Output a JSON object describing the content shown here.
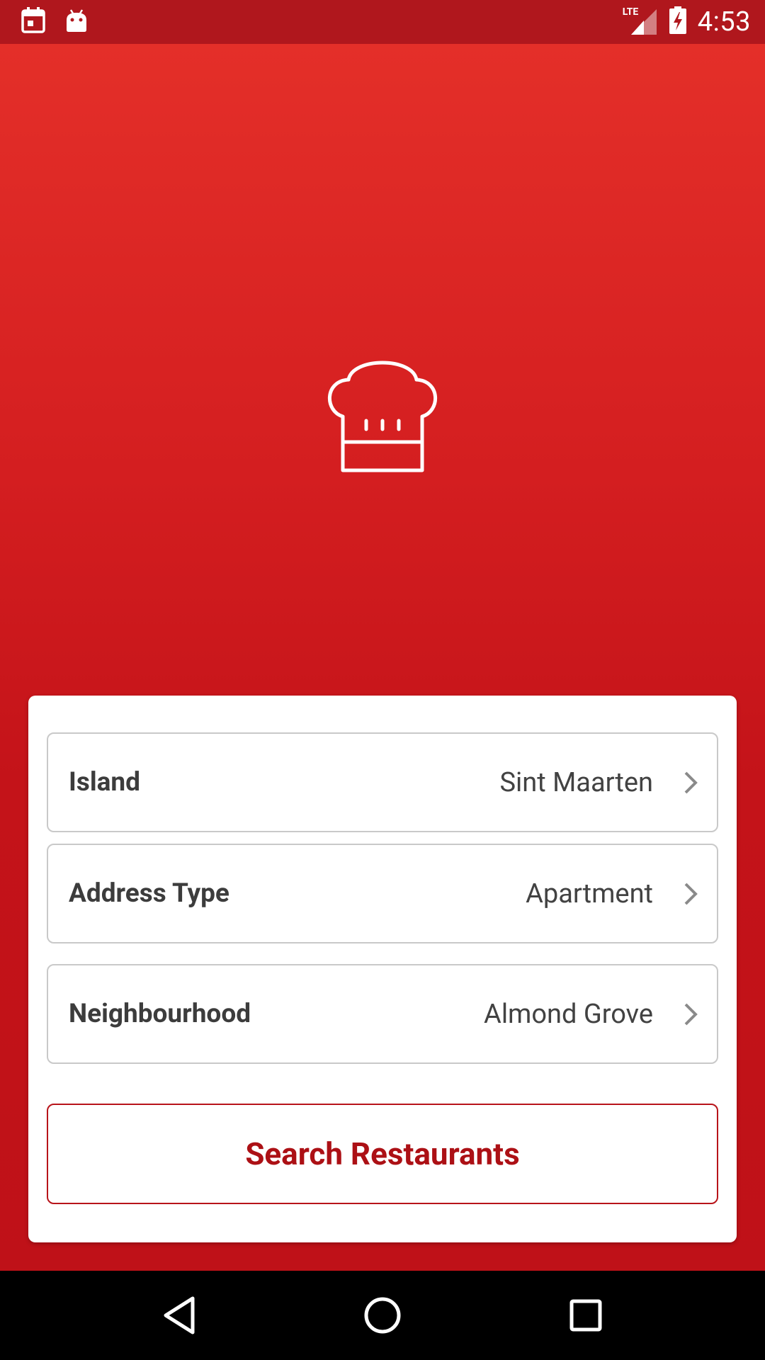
{
  "status_bar": {
    "time": "4:53",
    "network_label": "LTE",
    "icons": [
      "calendar-icon",
      "android-icon",
      "signal-icon",
      "battery-charging-icon"
    ]
  },
  "hero": {
    "logo_icon": "chef-hat-icon"
  },
  "form": {
    "rows": [
      {
        "label": "Island",
        "value": "Sint Maarten"
      },
      {
        "label": "Address Type",
        "value": "Apartment"
      },
      {
        "label": "Neighbourhood",
        "value": "Almond Grove"
      }
    ],
    "search_label": "Search Restaurants"
  },
  "nav_bar": {
    "icons": [
      "back-icon",
      "home-icon",
      "recents-icon"
    ]
  },
  "colors": {
    "brand_red": "#c31419",
    "status_bar": "#b0171d",
    "button_text": "#ac1015"
  }
}
